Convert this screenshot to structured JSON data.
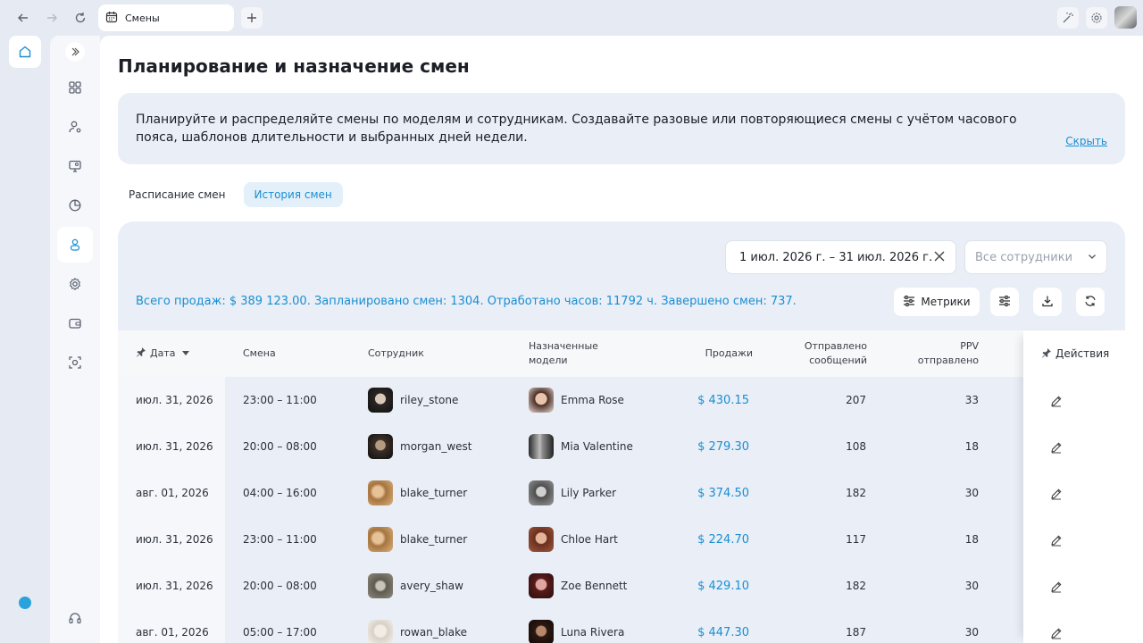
{
  "browser": {
    "tab_title": "Смены"
  },
  "page": {
    "title": "Планирование и назначение смен",
    "info_text": "Планируйте и распределяйте смены по моделям и сотрудникам. Создавайте разовые или повторяющиеся смены с учётом часового пояса, шаблонов длительности и выбранных дней недели.",
    "hide_label": "Скрыть"
  },
  "tabs": [
    {
      "label": "Расписание смен",
      "active": false
    },
    {
      "label": "История смен",
      "active": true
    }
  ],
  "filters": {
    "date_range": "1 июл. 2026 г. – 31 июл. 2026 г.",
    "employee_placeholder": "Все сотрудники"
  },
  "summary": "Всего продаж: $ 389 123.00. Запланировано смен: 1304. Отработано часов: 11792 ч. Завершено смен: 737.",
  "toolbar": {
    "metrics_label": "Метрики"
  },
  "table": {
    "headers": {
      "date": "Дата",
      "shift": "Смена",
      "employee": "Сотрудник",
      "models_line1": "Назначенные",
      "models_line2": "модели",
      "sales": "Продажи",
      "messages_line1": "Отправлено",
      "messages_line2": "сообщений",
      "ppv_line1": "PPV",
      "ppv_line2": "отправлено",
      "actions": "Действия"
    },
    "rows": [
      {
        "date": "июл. 31, 2026",
        "shift": "23:00 – 11:00",
        "employee": "riley_stone",
        "model": "Emma Rose",
        "sales": "$ 430.15",
        "messages": "207",
        "ppv": "33"
      },
      {
        "date": "июл. 31, 2026",
        "shift": "20:00 – 08:00",
        "employee": "morgan_west",
        "model": "Mia Valentine",
        "sales": "$ 279.30",
        "messages": "108",
        "ppv": "18"
      },
      {
        "date": "авг. 01, 2026",
        "shift": "04:00 – 16:00",
        "employee": "blake_turner",
        "model": "Lily Parker",
        "sales": "$ 374.50",
        "messages": "182",
        "ppv": "30"
      },
      {
        "date": "июл. 31, 2026",
        "shift": "23:00 – 11:00",
        "employee": "blake_turner",
        "model": "Chloe Hart",
        "sales": "$ 224.70",
        "messages": "117",
        "ppv": "18"
      },
      {
        "date": "июл. 31, 2026",
        "shift": "20:00 – 08:00",
        "employee": "avery_shaw",
        "model": "Zoe Bennett",
        "sales": "$ 429.10",
        "messages": "182",
        "ppv": "30"
      },
      {
        "date": "авг. 01, 2026",
        "shift": "05:00 – 17:00",
        "employee": "rowan_blake",
        "model": "Luna Rivera",
        "sales": "$ 447.30",
        "messages": "187",
        "ppv": "30"
      }
    ]
  },
  "colors": {
    "accent": "#1a8fd1",
    "panel_bg": "#e9eef7",
    "app_bg": "#e6ebf3"
  }
}
